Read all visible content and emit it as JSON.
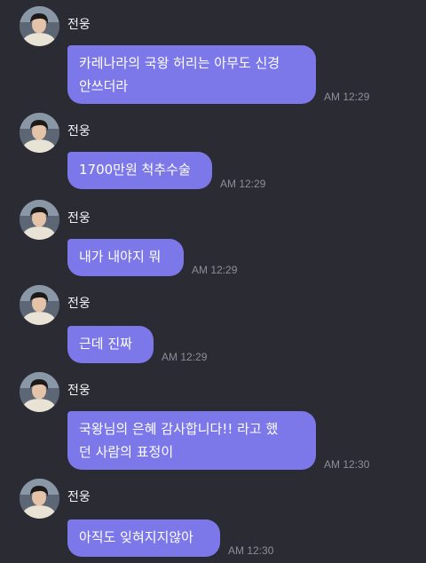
{
  "sender_name": "전웅",
  "colors": {
    "background": "#2b2b34",
    "bubble": "#7c78ea",
    "time_text": "#8e8e98"
  },
  "avatar_icon": "profile-photo",
  "messages": [
    {
      "text": "카레나라의 국왕 허리는 아무도 신경\n안쓰더라",
      "time": "AM 12:29"
    },
    {
      "text": "1700만원 척추수술",
      "time": "AM 12:29"
    },
    {
      "text": "내가 내야지 뭐",
      "time": "AM 12:29"
    },
    {
      "text": "근데 진짜",
      "time": "AM 12:29"
    },
    {
      "text": "국왕님의 은혜 감사합니다!! 라고 했\n던 사람의 표정이",
      "time": "AM 12:30"
    },
    {
      "text": "아직도 잊혀지지않아",
      "time": "AM 12:30"
    }
  ]
}
